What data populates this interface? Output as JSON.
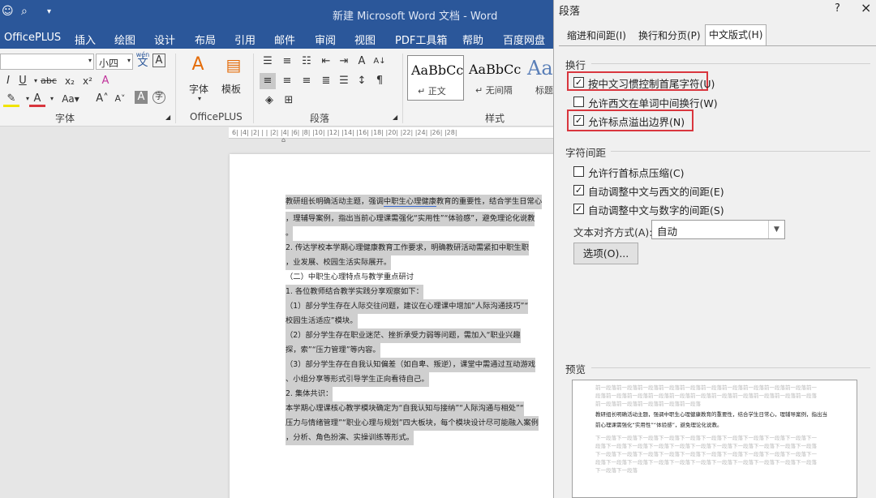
{
  "window": {
    "title": "新建 Microsoft Word 文档 - Word"
  },
  "ribbon_tabs": [
    "OfficePLUS",
    "插入",
    "绘图",
    "设计",
    "布局",
    "引用",
    "邮件",
    "审阅",
    "视图",
    "PDF工具箱",
    "帮助",
    "百度网盘"
  ],
  "font": {
    "size": "小四",
    "wen_label": "wén",
    "wen_char": "文"
  },
  "groups": {
    "font": "字体",
    "officeplus": "OfficePLUS",
    "paragraph": "段落",
    "styles": "样式"
  },
  "officeplus": {
    "font_btn": "字体",
    "template_btn": "模板"
  },
  "styles": [
    {
      "preview": "AaBbCc",
      "label": "↵ 正文"
    },
    {
      "preview": "AaBbCc",
      "label": "↵ 无间隔"
    },
    {
      "preview": "Aa",
      "label": "标题"
    }
  ],
  "ruler": "6| |4| |2| |  | |2| |4| |6| |8| |10| |12| |14| |16| |18| |20| |22| |24| |26| |28|",
  "document": {
    "lines": [
      "教研组长明确活动主题，强调中职生心理健康教育的重要性，结合学生日常心",
      "，理辅导案例，指出当前心理课需强化“实用性”“体验感”，避免理论化说教",
      "。",
      "    2.  传达学校本学期心理健康教育工作要求，明确教研活动需紧扣中职生职",
      "，业发展、校园生活实际展开。",
      "（二）中职生心理特点与教学重点研讨",
      "    1.  各位教师结合教学实践分享观察如下：",
      "    （1）部分学生存在人际交往问题，建议在心理课中增加“人际沟通技巧”“",
      "校园生活适应”模块。",
      "    （2）部分学生存在职业迷茫、挫折承受力弱等问题，需加入“职业兴趣",
      "探，索”“压力管理”等内容。",
      "    （3）部分学生存在自我认知偏差（如自卑、叛逆），课堂中需通过互动游戏",
      "、小组分享等形式引导学生正向看待自己。",
      "    2.  集体共识：",
      "    本学期心理课核心教学模块确定为“自我认知与接纳”“人际沟通与相处”“",
      "压力与情绪管理”“职业心理与规划”四大板块，每个模块设计尽可能融入案例",
      "，分析、角色扮演、实操训练等形式。"
    ]
  },
  "dialog": {
    "title": "段落",
    "help": "?",
    "close": "×",
    "tabs": [
      "缩进和间距(I)",
      "换行和分页(P)",
      "中文版式(H)"
    ],
    "sections": {
      "line_break": "换行",
      "char_spacing": "字符间距",
      "preview": "预览"
    },
    "options": [
      {
        "label": "按中文习惯控制首尾字符(U)",
        "checked": true
      },
      {
        "label": "允许西文在单词中间换行(W)",
        "checked": false
      },
      {
        "label": "允许标点溢出边界(N)",
        "checked": true
      },
      {
        "label": "允许行首标点压缩(C)",
        "checked": false
      },
      {
        "label": "自动调整中文与西文的间距(E)",
        "checked": true
      },
      {
        "label": "自动调整中文与数字的间距(S)",
        "checked": true
      }
    ],
    "check_mark": "✓",
    "align_label": "文本对齐方式(A):",
    "align_value": "自动",
    "options_button": "选项(O)...",
    "preview": {
      "prev": [
        "前一段落前一段落前一段落前一段落前一段落前一段落前一段落前一段落前一段落前一段落前一",
        "段落前一段落前一段落前一段落前一段落前一段落前一段落前一段落前一段落前一段落前一段落",
        "前一段落前一段落前一段落前一段落前一段落"
      ],
      "sample": [
        "教研组长明确活动主题，强调中职生心理健康教育的重要性，结合学生日常心，理辅导案例，指出当",
        "前心理课需强化“实用性”“体验感”，避免理论化说教。"
      ],
      "next": [
        "下一段落下一段落下一段落下一段落下一段落下一段落下一段落下一段落下一段落下一段落下一",
        "段落下一段落下一段落下一段落下一段落下一段落下一段落下一段落下一段落下一段落下一段落",
        "下一段落下一段落下一段落下一段落下一段落下一段落下一段落下一段落下一段落下一段落下一",
        "段落下一段落下一段落下一段落下一段落下一段落下一段落下一段落下一段落下一段落下一段落",
        "下一段落下一段落"
      ]
    }
  },
  "colors": {
    "accent": "#2b579a",
    "highlight_box": "#d9363e"
  }
}
